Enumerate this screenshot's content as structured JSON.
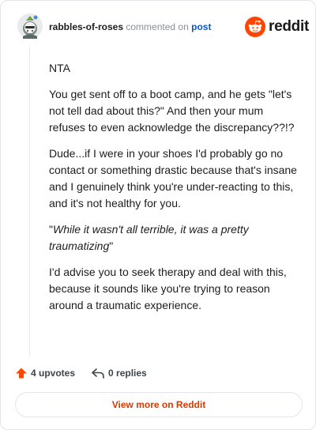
{
  "comment": {
    "username": "rabbles-of-roses",
    "commented_text": "commented on",
    "post_link": "post",
    "body": {
      "p1": "NTA",
      "p2": "You get sent off to a boot camp, and he gets \"let's not tell dad about this?\" And then your mum refuses to even acknowledge the discrepancy??!?",
      "p3": "Dude...if I were in your shoes I'd probably go no contact or something drastic because that's insane and I genuinely think you're under-reacting to this, and it's not healthy for you.",
      "p4_quote_open": "\"",
      "p4_italic": "While it wasn't all terrible, it was a pretty traumatizing",
      "p4_quote_close": "\"",
      "p5": "I'd advise you to seek therapy and deal with this, because it sounds like you're trying to reason around a traumatic experience."
    },
    "upvotes_label": "4 upvotes",
    "replies_label": "0 replies"
  },
  "brand": {
    "wordmark": "reddit",
    "color": "#ff4500"
  },
  "footer": {
    "view_more_label": "View more on Reddit"
  },
  "icons": {
    "avatar": "avatar",
    "reddit_logo": "reddit-snoo-icon",
    "upvote": "upvote-arrow-icon",
    "reply": "reply-arrow-icon"
  }
}
